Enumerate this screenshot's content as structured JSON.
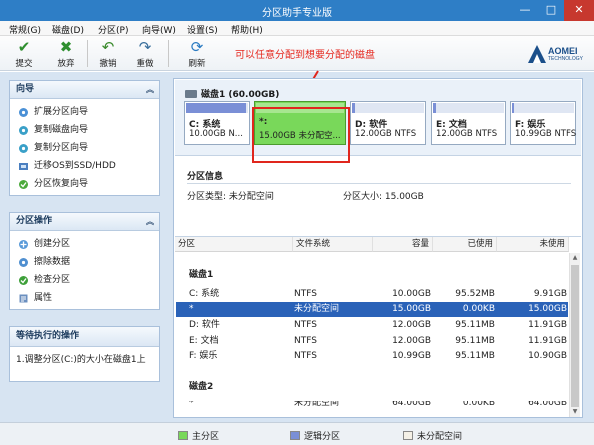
{
  "window": {
    "title": "分区助手专业版",
    "controls": {
      "minimize": "—",
      "maximize": "□",
      "close": "✕"
    }
  },
  "menu": [
    "常规(G)",
    "磁盘(D)",
    "分区(P)",
    "向导(W)",
    "设置(S)",
    "帮助(H)"
  ],
  "toolbar": {
    "buttons": [
      {
        "label": "提交",
        "icon": "check-icon",
        "glyph": "✔",
        "color": "#2f8f2f"
      },
      {
        "label": "放弃",
        "icon": "discard-icon",
        "glyph": "✖",
        "color": "#2f8f2f"
      },
      {
        "label": "撤销",
        "icon": "undo-icon",
        "glyph": "↶",
        "color": "#3a8a2c"
      },
      {
        "label": "重做",
        "icon": "redo-icon",
        "glyph": "↷",
        "color": "#3a6f9c"
      },
      {
        "label": "刷新",
        "icon": "refresh-icon",
        "glyph": "⟳",
        "color": "#2b7bc2"
      }
    ],
    "hint": "可以任意分配到想要分配的磁盘",
    "logo": {
      "brand": "AOMEI",
      "sub": "TECHNOLOGY"
    }
  },
  "sidebar": {
    "wizard": {
      "title": "向导",
      "items": [
        {
          "label": "扩展分区向导",
          "icon": "extend-partition-icon"
        },
        {
          "label": "复制磁盘向导",
          "icon": "copy-disk-icon"
        },
        {
          "label": "复制分区向导",
          "icon": "copy-partition-icon"
        },
        {
          "label": "迁移OS到SSD/HDD",
          "icon": "migrate-os-icon"
        },
        {
          "label": "分区恢复向导",
          "icon": "recovery-icon"
        }
      ]
    },
    "operations": {
      "title": "分区操作",
      "items": [
        {
          "label": "创建分区",
          "icon": "create-partition-icon"
        },
        {
          "label": "擦除数据",
          "icon": "wipe-data-icon"
        },
        {
          "label": "检查分区",
          "icon": "check-partition-icon"
        },
        {
          "label": "属性",
          "icon": "properties-icon"
        }
      ]
    },
    "pending": {
      "title": "等待执行的操作",
      "items": [
        "1.调整分区(C:)的大小在磁盘1上"
      ]
    }
  },
  "disk_map": {
    "label": "磁盘1 (60.00GB)",
    "partitions": [
      {
        "name": "C: 系统",
        "size": "10.00GB N...",
        "bar_color": "#7a8fd6",
        "used_fraction": 0.96
      },
      {
        "name": "*:",
        "size": "15.00GB 未分配空...",
        "bar_color": "#79d85a",
        "used_fraction": 1.0
      },
      {
        "name": "D: 软件",
        "size": "12.00GB NTFS",
        "bar_color": "#7a8fd6",
        "used_fraction": 0.01
      },
      {
        "name": "E: 文档",
        "size": "12.00GB NTFS",
        "bar_color": "#7a8fd6",
        "used_fraction": 0.01
      },
      {
        "name": "F: 娱乐",
        "size": "10.99GB NTFS",
        "bar_color": "#7a8fd6",
        "used_fraction": 0.01
      }
    ]
  },
  "partition_info": {
    "title": "分区信息",
    "type": "分区类型: 未分配空间",
    "size": "分区大小: 15.00GB"
  },
  "table": {
    "headers": [
      "分区",
      "文件系统",
      "容量",
      "已使用",
      "未使用"
    ],
    "groups": [
      {
        "name": "磁盘1",
        "rows": [
          [
            "C: 系统",
            "NTFS",
            "10.00GB",
            "95.52MB",
            "9.91GB"
          ],
          [
            "*",
            "未分配空间",
            "15.00GB",
            "0.00KB",
            "15.00GB"
          ],
          [
            "D: 软件",
            "NTFS",
            "12.00GB",
            "95.11MB",
            "11.91GB"
          ],
          [
            "E: 文档",
            "NTFS",
            "12.00GB",
            "95.11MB",
            "11.91GB"
          ],
          [
            "F: 娱乐",
            "NTFS",
            "10.99GB",
            "95.11MB",
            "10.90GB"
          ]
        ]
      },
      {
        "name": "磁盘2",
        "rows": [
          [
            "*",
            "未分配空间",
            "64.00GB",
            "0.00KB",
            "64.00GB"
          ]
        ]
      }
    ],
    "selected_row": "*"
  },
  "legend": [
    {
      "label": "主分区",
      "color": "#79d85a"
    },
    {
      "label": "逻辑分区",
      "color": "#7a8fd6"
    },
    {
      "label": "未分配空间",
      "color": "#f4f0e6"
    }
  ]
}
